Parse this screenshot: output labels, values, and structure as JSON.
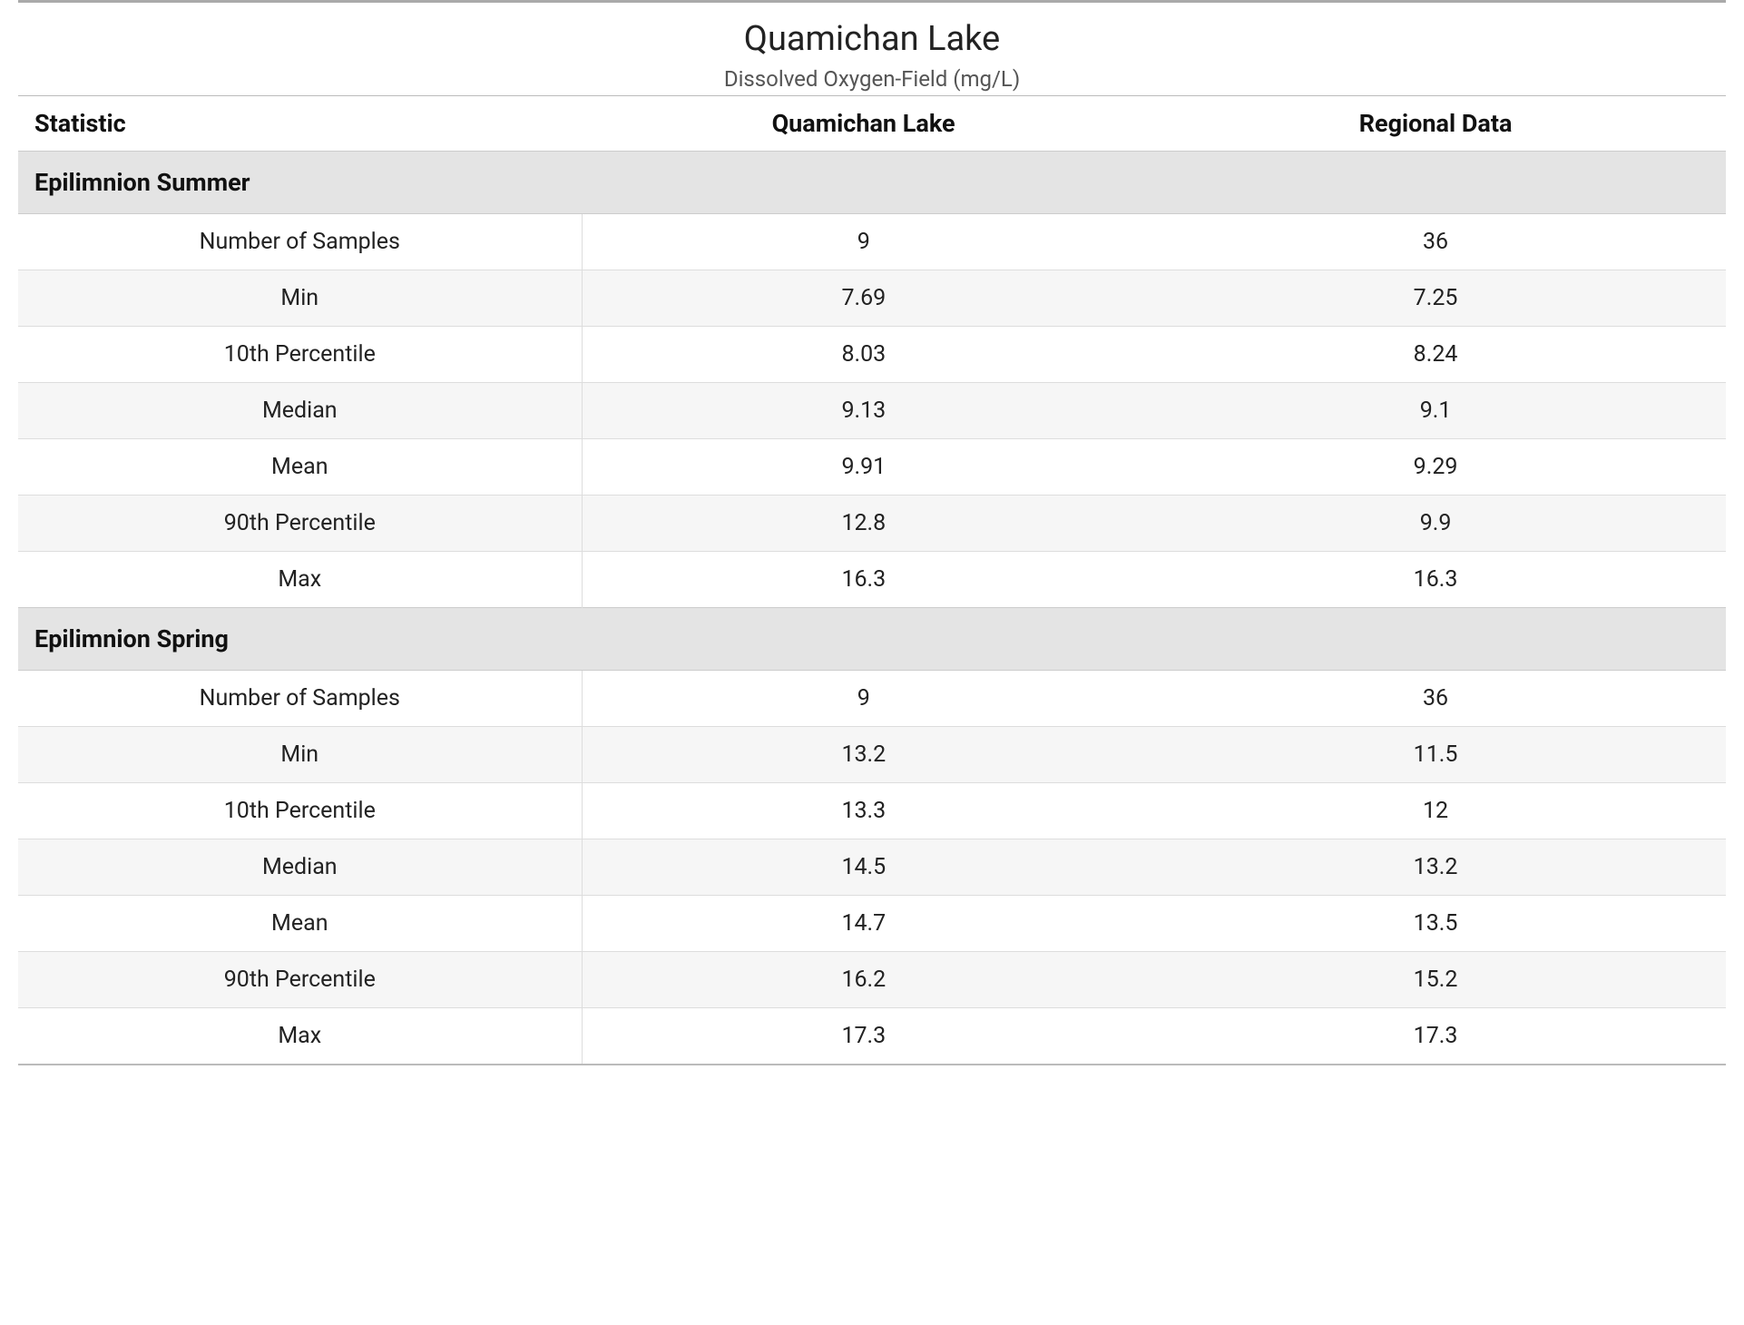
{
  "header": {
    "title": "Quamichan Lake",
    "subtitle": "Dissolved Oxygen-Field (mg/L)"
  },
  "columns": {
    "stat": "Statistic",
    "site": "Quamichan Lake",
    "regional": "Regional Data"
  },
  "sections": [
    {
      "name": "Epilimnion Summer",
      "rows": [
        {
          "stat": "Number of Samples",
          "site": "9",
          "regional": "36"
        },
        {
          "stat": "Min",
          "site": "7.69",
          "regional": "7.25"
        },
        {
          "stat": "10th Percentile",
          "site": "8.03",
          "regional": "8.24"
        },
        {
          "stat": "Median",
          "site": "9.13",
          "regional": "9.1"
        },
        {
          "stat": "Mean",
          "site": "9.91",
          "regional": "9.29"
        },
        {
          "stat": "90th Percentile",
          "site": "12.8",
          "regional": "9.9"
        },
        {
          "stat": "Max",
          "site": "16.3",
          "regional": "16.3"
        }
      ]
    },
    {
      "name": "Epilimnion Spring",
      "rows": [
        {
          "stat": "Number of Samples",
          "site": "9",
          "regional": "36"
        },
        {
          "stat": "Min",
          "site": "13.2",
          "regional": "11.5"
        },
        {
          "stat": "10th Percentile",
          "site": "13.3",
          "regional": "12"
        },
        {
          "stat": "Median",
          "site": "14.5",
          "regional": "13.2"
        },
        {
          "stat": "Mean",
          "site": "14.7",
          "regional": "13.5"
        },
        {
          "stat": "90th Percentile",
          "site": "16.2",
          "regional": "15.2"
        },
        {
          "stat": "Max",
          "site": "17.3",
          "regional": "17.3"
        }
      ]
    }
  ],
  "chart_data": {
    "type": "table",
    "title": "Quamichan Lake — Dissolved Oxygen-Field (mg/L)",
    "columns": [
      "Statistic",
      "Quamichan Lake",
      "Regional Data"
    ],
    "groups": [
      {
        "name": "Epilimnion Summer",
        "rows": [
          [
            "Number of Samples",
            9,
            36
          ],
          [
            "Min",
            7.69,
            7.25
          ],
          [
            "10th Percentile",
            8.03,
            8.24
          ],
          [
            "Median",
            9.13,
            9.1
          ],
          [
            "Mean",
            9.91,
            9.29
          ],
          [
            "90th Percentile",
            12.8,
            9.9
          ],
          [
            "Max",
            16.3,
            16.3
          ]
        ]
      },
      {
        "name": "Epilimnion Spring",
        "rows": [
          [
            "Number of Samples",
            9,
            36
          ],
          [
            "Min",
            13.2,
            11.5
          ],
          [
            "10th Percentile",
            13.3,
            12
          ],
          [
            "Median",
            14.5,
            13.2
          ],
          [
            "Mean",
            14.7,
            13.5
          ],
          [
            "90th Percentile",
            16.2,
            15.2
          ],
          [
            "Max",
            17.3,
            17.3
          ]
        ]
      }
    ]
  }
}
